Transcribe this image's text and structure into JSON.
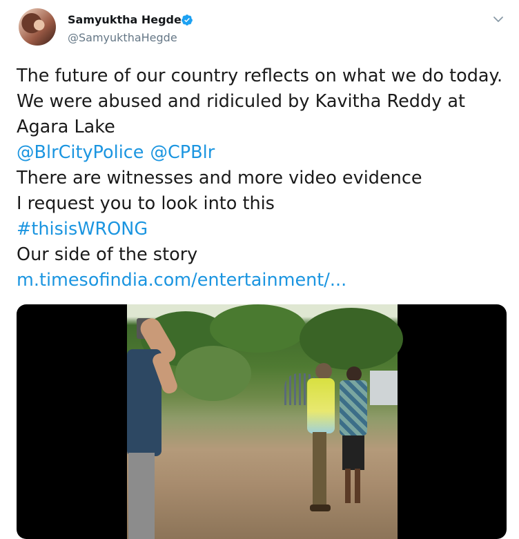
{
  "author": {
    "name": "Samyuktha Hegde",
    "handle": "@SamyukthaHegde",
    "verified": true
  },
  "tweet": {
    "line1": "The future of our country reflects on what we do today.",
    "line2": "We were abused and ridiculed by Kavitha Reddy at",
    "line3": "Agara Lake",
    "mention1": "@BlrCityPolice",
    "mention2": "@CPBlr",
    "line5": "There are witnesses and more video evidence",
    "line6": "I request you to look into this",
    "hashtag": "#thisisWRONG",
    "line8": "Our side of the story",
    "url": "m.timesofindia.com/entertainment/..."
  },
  "colors": {
    "link": "#1b95e0",
    "verified": "#1da1f2",
    "handle": "#657786"
  },
  "icons": {
    "verified": "verified-badge-icon",
    "menu": "chevron-down-icon"
  }
}
